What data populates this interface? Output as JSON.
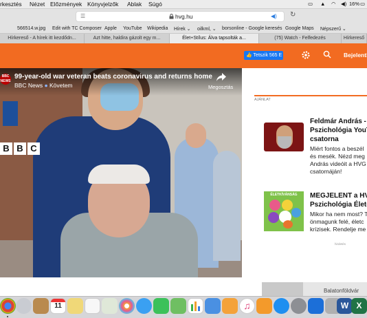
{
  "menubar": {
    "items": [
      "rkesztés",
      "Nézet",
      "Előzmények",
      "Könyvjelzők",
      "Ablak",
      "Súgó"
    ],
    "battery": "16%"
  },
  "toolbar": {
    "url": "hvg.hu"
  },
  "bookmarks": [
    "566514.w.jpg",
    "Edit with TC Composer",
    "Apple",
    "YouTube",
    "Wikipedia",
    "Hírek ⌄",
    "oilkml, ⌄",
    "borsonline - Google keresés",
    "Google Maps",
    "Népszerű ⌄"
  ],
  "tabs": [
    {
      "label": "Hírkereső - A hírek itt kezdődn...",
      "active": false
    },
    {
      "label": "Azt hitte, haldira gázolt egy m...",
      "active": false
    },
    {
      "label": "Élet+Stílus: Álva tapsolták a...",
      "active": true
    },
    {
      "label": "(75) Watch - Felfedezés",
      "active": false
    },
    {
      "label": "Hírkereső",
      "active": false
    }
  ],
  "header": {
    "like_button": "Tetszik 565 E",
    "login": "Bejelentk"
  },
  "video": {
    "channel_badge": "BBC NEWS",
    "title": "99-year-old war veteran beats coronavirus and returns home",
    "channel": "BBC News",
    "follow": "Követem",
    "share": "Megosztás",
    "watermark": "BBC"
  },
  "sidebar": {
    "section_label": "AJÁNLAT",
    "articles": [
      {
        "title_lines": [
          "Feldmár András -",
          "Pszichológia YouT",
          "csatorna"
        ],
        "desc_lines": [
          "Miért fontos a beszél",
          "és mesék. Nézd meg ",
          "András videóit a HVG",
          "csatornáján!"
        ]
      },
      {
        "title_lines": [
          "MEGJELENT a HV",
          "Pszichológia Életc"
        ],
        "desc_lines": [
          "Mikor ha nem most? T",
          "önmagunk felé, életc",
          "krízisek. Rendelje me"
        ],
        "image_title": "ÉLETKÍVÁNSÁG"
      }
    ],
    "ad_label": "hirdetés",
    "ad_text": "Balatonföldvár"
  },
  "dock": {
    "apps": [
      "chrome",
      "launchpad",
      "notes",
      "calendar",
      "reminders",
      "preview",
      "photos",
      "messages",
      "facetime",
      "maps",
      "numbers",
      "keynote",
      "pages",
      "itunes",
      "ibooks",
      "appstore",
      "settings",
      "teamviewer",
      "parental",
      "word",
      "excel",
      "sketch"
    ],
    "calendar_day": "11"
  }
}
